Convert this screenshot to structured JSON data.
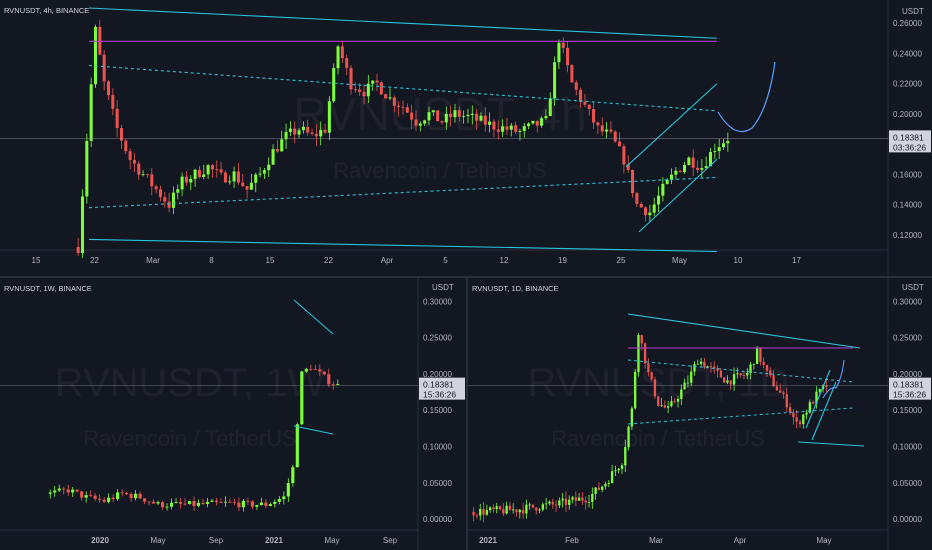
{
  "charts": [
    {
      "id": "main",
      "title": "RVNUSDT, 4h, BINANCE",
      "watermark_symbol": "RVNUSDT, 4h",
      "watermark_name": "Ravencoin / TetherUS",
      "unit": "USDT",
      "price_label": "0.18381",
      "countdown_label": "03:36:26",
      "y_ticks": [
        "0.26000",
        "0.24000",
        "0.22000",
        "0.20000",
        "0.18000",
        "0.16000",
        "0.14000",
        "0.12000"
      ],
      "x_ticks": [
        "15",
        "22",
        "Mar",
        "8",
        "15",
        "22",
        "Apr",
        "5",
        "12",
        "19",
        "25",
        "May",
        "10",
        "17"
      ]
    },
    {
      "id": "weekly",
      "title": "RVNUSDT, 1W, BINANCE",
      "watermark_symbol": "RVNUSDT, 1W",
      "watermark_name": "Ravencoin / TetherUS",
      "unit": "USDT",
      "price_label": "0.18381",
      "countdown_label": "15:36:26",
      "y_ticks": [
        "0.30000",
        "0.25000",
        "0.20000",
        "0.15000",
        "0.10000",
        "0.05000",
        "0.00000"
      ],
      "x_ticks": [
        "2020",
        "May",
        "Sep",
        "2021",
        "May",
        "Sep"
      ]
    },
    {
      "id": "daily",
      "title": "RVNUSDT, 1D, BINANCE",
      "watermark_symbol": "RVNUSDT, 1D",
      "watermark_name": "Ravencoin / TetherUS",
      "unit": "USDT",
      "price_label": "0.18381",
      "countdown_label": "15:36:26",
      "y_ticks": [
        "0.30000",
        "0.25000",
        "0.20000",
        "0.15000",
        "0.10000",
        "0.05000",
        "0.00000"
      ],
      "x_ticks": [
        "2021",
        "Feb",
        "Mar",
        "Apr",
        "May"
      ]
    }
  ],
  "colors": {
    "up": "#4caf50",
    "up_bright": "#7cff3a",
    "down": "#ef5350",
    "trend": "#26c6da",
    "resistance": "#b040d0",
    "projection": "#5aa0ff",
    "axis_text": "#b2b5be"
  },
  "chart_data": [
    {
      "type": "candlestick",
      "title": "RVNUSDT, 4h, BINANCE",
      "ylabel": "USDT",
      "ylim": [
        0.11,
        0.27
      ],
      "x_categories": [
        "15",
        "22",
        "Mar",
        "8",
        "15",
        "22",
        "Apr",
        "5",
        "12",
        "19",
        "25",
        "May",
        "10",
        "17"
      ],
      "last_price": 0.18381,
      "price_path": [
        [
          0,
          0.112
        ],
        [
          4,
          0.255
        ],
        [
          6,
          0.22
        ],
        [
          9,
          0.19
        ],
        [
          12,
          0.17
        ],
        [
          15,
          0.16
        ],
        [
          18,
          0.15
        ],
        [
          21,
          0.14
        ],
        [
          24,
          0.155
        ],
        [
          27,
          0.16
        ],
        [
          30,
          0.165
        ],
        [
          33,
          0.158
        ],
        [
          36,
          0.16
        ],
        [
          39,
          0.15
        ],
        [
          42,
          0.16
        ],
        [
          45,
          0.175
        ],
        [
          48,
          0.185
        ],
        [
          51,
          0.19
        ],
        [
          54,
          0.185
        ],
        [
          57,
          0.19
        ],
        [
          60,
          0.245
        ],
        [
          63,
          0.22
        ],
        [
          66,
          0.215
        ],
        [
          69,
          0.22
        ],
        [
          72,
          0.21
        ],
        [
          75,
          0.205
        ],
        [
          78,
          0.195
        ],
        [
          81,
          0.2
        ],
        [
          84,
          0.195
        ],
        [
          87,
          0.2
        ],
        [
          90,
          0.198
        ],
        [
          93,
          0.195
        ],
        [
          96,
          0.192
        ],
        [
          99,
          0.19
        ],
        [
          102,
          0.188
        ],
        [
          105,
          0.192
        ],
        [
          108,
          0.195
        ],
        [
          111,
          0.25
        ],
        [
          114,
          0.22
        ],
        [
          117,
          0.205
        ],
        [
          120,
          0.19
        ],
        [
          123,
          0.185
        ],
        [
          126,
          0.17
        ],
        [
          129,
          0.14
        ],
        [
          132,
          0.135
        ],
        [
          135,
          0.15
        ],
        [
          138,
          0.162
        ],
        [
          141,
          0.17
        ],
        [
          144,
          0.165
        ],
        [
          147,
          0.178
        ],
        [
          150,
          0.184
        ]
      ],
      "trendlines": [
        {
          "name": "descending-resistance",
          "points": [
            [
              3,
              0.27
            ],
            [
              148,
              0.25
            ]
          ],
          "style": "solid"
        },
        {
          "name": "horizontal-resistance",
          "points": [
            [
              3,
              0.248
            ],
            [
              148,
              0.248
            ]
          ],
          "style": "solid"
        },
        {
          "name": "upper-mid-channel",
          "points": [
            [
              3,
              0.232
            ],
            [
              148,
              0.202
            ]
          ],
          "style": "dashed"
        },
        {
          "name": "lower-mid-channel",
          "points": [
            [
              3,
              0.138
            ],
            [
              148,
              0.158
            ]
          ],
          "style": "dashed"
        },
        {
          "name": "support",
          "points": [
            [
              3,
              0.117
            ],
            [
              148,
              0.109
            ]
          ],
          "style": "solid"
        },
        {
          "name": "rising-channel-top",
          "points": [
            [
              127,
              0.165
            ],
            [
              148,
              0.22
            ]
          ],
          "style": "solid"
        },
        {
          "name": "rising-channel-bottom",
          "points": [
            [
              130,
              0.122
            ],
            [
              148,
              0.17
            ]
          ],
          "style": "solid"
        }
      ]
    },
    {
      "type": "candlestick",
      "title": "RVNUSDT, 1W, BINANCE",
      "ylabel": "USDT",
      "ylim": [
        -0.015,
        0.31
      ],
      "x_categories": [
        "2020",
        "May",
        "Sep",
        "2021",
        "May",
        "Sep"
      ],
      "last_price": 0.18381,
      "price_path": [
        [
          0,
          0.035
        ],
        [
          4,
          0.04
        ],
        [
          8,
          0.03
        ],
        [
          12,
          0.025
        ],
        [
          16,
          0.035
        ],
        [
          20,
          0.03
        ],
        [
          24,
          0.02
        ],
        [
          28,
          0.02
        ],
        [
          32,
          0.02
        ],
        [
          36,
          0.021
        ],
        [
          40,
          0.022
        ],
        [
          44,
          0.02
        ],
        [
          48,
          0.02
        ],
        [
          52,
          0.03
        ],
        [
          54,
          0.07
        ],
        [
          56,
          0.2
        ],
        [
          58,
          0.21
        ],
        [
          60,
          0.2
        ],
        [
          62,
          0.19
        ],
        [
          64,
          0.184
        ]
      ]
    },
    {
      "type": "candlestick",
      "title": "RVNUSDT, 1D, BINANCE",
      "ylabel": "USDT",
      "ylim": [
        -0.015,
        0.31
      ],
      "x_categories": [
        "2021",
        "Feb",
        "Mar",
        "Apr",
        "May"
      ],
      "last_price": 0.18381,
      "price_path": [
        [
          0,
          0.01
        ],
        [
          5,
          0.011
        ],
        [
          10,
          0.012
        ],
        [
          15,
          0.014
        ],
        [
          20,
          0.018
        ],
        [
          25,
          0.02
        ],
        [
          30,
          0.025
        ],
        [
          35,
          0.03
        ],
        [
          40,
          0.05
        ],
        [
          45,
          0.08
        ],
        [
          48,
          0.15
        ],
        [
          50,
          0.26
        ],
        [
          53,
          0.2
        ],
        [
          56,
          0.16
        ],
        [
          59,
          0.15
        ],
        [
          62,
          0.17
        ],
        [
          65,
          0.19
        ],
        [
          68,
          0.22
        ],
        [
          71,
          0.21
        ],
        [
          74,
          0.2
        ],
        [
          77,
          0.19
        ],
        [
          80,
          0.195
        ],
        [
          83,
          0.2
        ],
        [
          86,
          0.23
        ],
        [
          89,
          0.2
        ],
        [
          92,
          0.18
        ],
        [
          95,
          0.16
        ],
        [
          98,
          0.13
        ],
        [
          101,
          0.15
        ],
        [
          104,
          0.17
        ],
        [
          107,
          0.184
        ]
      ]
    }
  ]
}
